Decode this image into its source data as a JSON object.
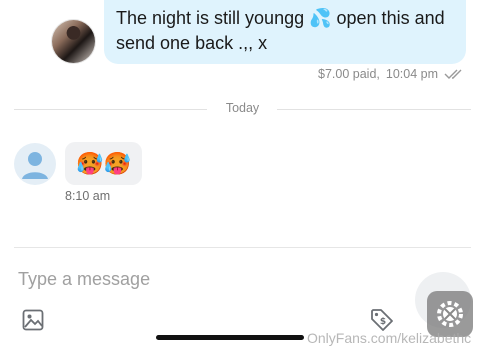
{
  "conversation": {
    "sent_message": {
      "text": "The night is still youngg 💦 open this and send one back .,, x",
      "price": "$7.00 paid,",
      "time": "10:04 pm"
    },
    "date_divider": "Today",
    "received_message": {
      "text": "🥵🥵",
      "time": "8:10 am"
    }
  },
  "composer": {
    "placeholder": "Type a message"
  },
  "watermark": {
    "text": "OnlyFans.com/kelizabethc"
  },
  "colors": {
    "sent_bubble": "#dff3fd",
    "received_bubble": "#f0f1f3",
    "meta_text": "#8a8a8a"
  }
}
